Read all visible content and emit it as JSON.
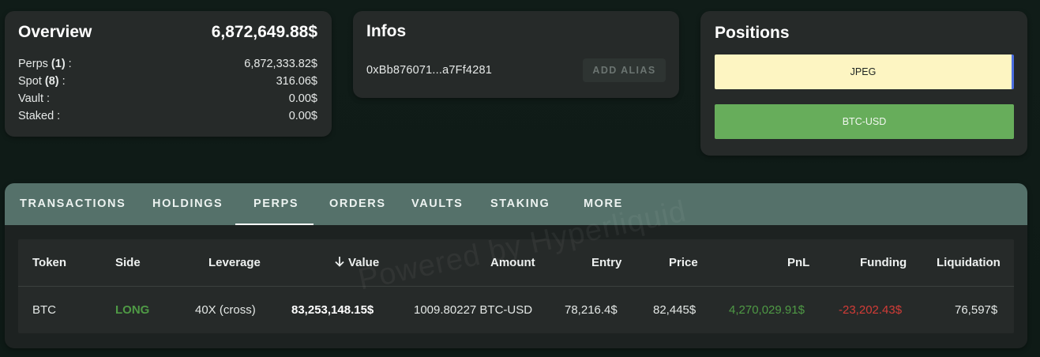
{
  "overview": {
    "title": "Overview",
    "total": "6,872,649.88$",
    "rows": [
      {
        "label": "Perps ",
        "count": "(1)",
        "suffix": " :",
        "value": "6,872,333.82$"
      },
      {
        "label": "Spot ",
        "count": "(8)",
        "suffix": " :",
        "value": "316.06$"
      },
      {
        "label": "Vault :",
        "count": "",
        "suffix": "",
        "value": "0.00$"
      },
      {
        "label": "Staked :",
        "count": "",
        "suffix": "",
        "value": "0.00$"
      }
    ]
  },
  "infos": {
    "title": "Infos",
    "address": "0xBb876071...a7Ff4281",
    "alias_button": "ADD ALIAS"
  },
  "positions": {
    "title": "Positions",
    "items": [
      {
        "label": "JPEG",
        "color": "#fdf5c2"
      },
      {
        "label": "BTC-USD",
        "color": "#67ad5b"
      }
    ]
  },
  "tabs": {
    "items": [
      "TRANSACTIONS",
      "HOLDINGS",
      "PERPS",
      "ORDERS",
      "VAULTS",
      "STAKING",
      "MORE"
    ],
    "active": "PERPS"
  },
  "table": {
    "headers": {
      "token": "Token",
      "side": "Side",
      "leverage": "Leverage",
      "value": "Value",
      "amount": "Amount",
      "entry": "Entry",
      "price": "Price",
      "pnl": "PnL",
      "funding": "Funding",
      "liquidation": "Liquidation"
    },
    "rows": [
      {
        "token": "BTC",
        "side": "LONG",
        "leverage": "40X (cross)",
        "value": "83,253,148.15$",
        "amount": "1009.80227 BTC-USD",
        "entry": "78,216.4$",
        "price": "82,445$",
        "pnl": "4,270,029.91$",
        "funding": "-23,202.43$",
        "liquidation": "76,597$"
      }
    ]
  },
  "watermark": "Powered by Hyperliquid",
  "colors": {
    "long": "#4f9a45",
    "negative": "#d23c37",
    "tabbar": "#55716a"
  }
}
